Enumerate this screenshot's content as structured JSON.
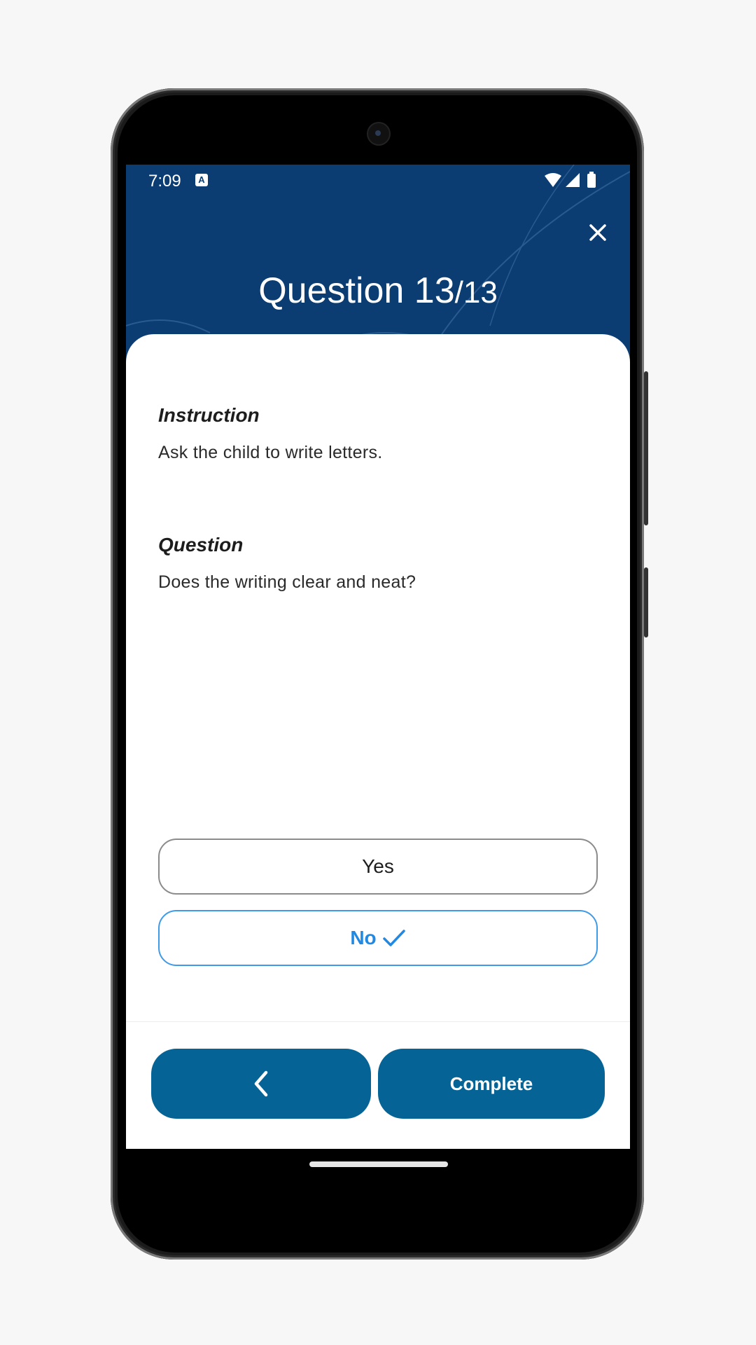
{
  "status_bar": {
    "time": "7:09",
    "notification_icon": "a-letter-icon",
    "icons": [
      "wifi-icon",
      "signal-icon",
      "battery-icon"
    ]
  },
  "header": {
    "title_prefix": "Question 13",
    "title_total": "/13",
    "close_icon": "close-icon",
    "background_color": "#0b3d72"
  },
  "instruction": {
    "heading": "Instruction",
    "text": "Ask the child to write letters."
  },
  "question": {
    "heading": "Question",
    "text": "Does the writing clear and neat?"
  },
  "options": [
    {
      "label": "Yes",
      "selected": false
    },
    {
      "label": "No",
      "selected": true
    }
  ],
  "footer": {
    "back_icon": "chevron-left-icon",
    "complete_label": "Complete",
    "button_color": "#056396"
  },
  "colors": {
    "selected_accent": "#2289e3"
  }
}
